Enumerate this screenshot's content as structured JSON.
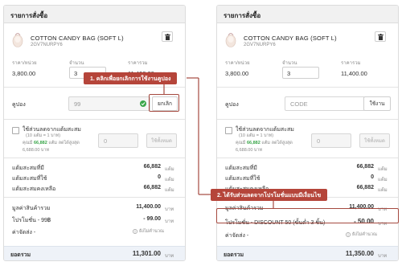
{
  "panel_title": "รายการสั่งซื้อ",
  "product": {
    "name": "COTTON CANDY BAG (SOFT L)",
    "sku": "2GV7NURPY6"
  },
  "labels": {
    "unit_price": "ราคา/หน่วย",
    "qty": "จำนวน",
    "total_price": "ราคารวม"
  },
  "values": {
    "unit_price": "3,800.00",
    "qty": "3",
    "total_price": "11,400.00"
  },
  "coupon": {
    "label": "คูปอง",
    "applied_value": "99",
    "cancel_label": "ยกเลิก",
    "placeholder": "CODE",
    "use_label": "ใช้งาน"
  },
  "points": {
    "title": "ใช้ส่วนลดจากแต้มสะสม",
    "rate": "(10 แต้ม = 1 บาท)",
    "info_prefix": "คุณมี",
    "info_points": "66,882",
    "info_suffix": "แต้ม ลดได้สูงสุด",
    "max_discount": "6,688.00 บาท",
    "input_value": "0",
    "use_label": "ใช้ทั้งหมด"
  },
  "points_summary": [
    {
      "label": "แต้มสะสมที่มี",
      "value": "66,882",
      "unit": "แต้ม"
    },
    {
      "label": "แต้มสะสมที่ใช้",
      "value": "0",
      "unit": "แต้ม"
    },
    {
      "label": "แต้มสะสมคงเหลือ",
      "value": "66,882",
      "unit": "แต้ม"
    }
  ],
  "left_summary": {
    "subtotal_label": "มูลค่าสินค้ารวม",
    "subtotal_value": "11,400.00",
    "unit": "บาท",
    "promo_label": "โปรโมชั่น - 99฿",
    "promo_value": "- 99.00",
    "shipping_label": "ค่าจัดส่ง -",
    "shipping_value": "ยังไม่คำนวณ",
    "total_label": "ยอดรวม",
    "total_value": "11,301.00"
  },
  "right_summary": {
    "subtotal_label": "มูลค่าสินค้ารวม",
    "subtotal_value": "11,400.00",
    "unit": "บาท",
    "promo_label": "โปรโมชั่น - DISCOUNT 50 (ขั้นต่ำ 3 ชิ้น)",
    "promo_value": "- 50.00",
    "shipping_label": "ค่าจัดส่ง -",
    "shipping_value": "ยังไม่คำนวณ",
    "total_label": "ยอดรวม",
    "total_value": "11,350.00"
  },
  "callouts": {
    "one": "1. คลิกเพื่อยกเลิกการใช้งานคูปอง",
    "two": "2. ได้รับส่วนลดจากโปรโมชั่นแบบมีเงื่อนไข"
  },
  "colors": {
    "callout": "#b5453a",
    "points_green": "#3aa64a",
    "total_bar": "#eef2f8"
  }
}
